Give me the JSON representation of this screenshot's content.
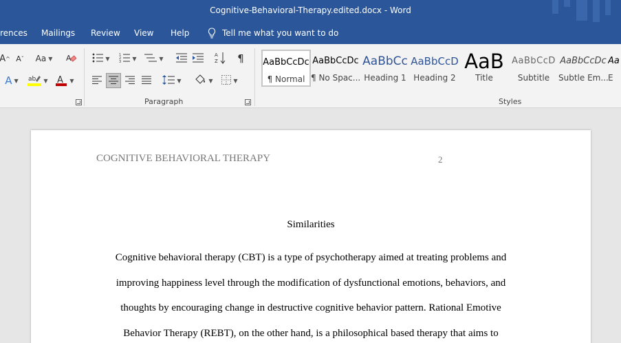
{
  "window": {
    "title": "Cognitive-Behavioral-Therapy.edited.docx  -  Word"
  },
  "ribbon_tabs": [
    "rences",
    "Mailings",
    "Review",
    "View",
    "Help"
  ],
  "tell_me": "Tell me what you want to do",
  "groups": {
    "paragraph": "Paragraph",
    "styles": "Styles"
  },
  "font_group": {
    "change_case": "Aa"
  },
  "styles": [
    {
      "sample": "AaBbCcDc",
      "name": "¶ Normal"
    },
    {
      "sample": "AaBbCcDc",
      "name": "¶ No Spac..."
    },
    {
      "sample": "AaBbCc",
      "name": "Heading 1"
    },
    {
      "sample": "AaBbCcD",
      "name": "Heading 2"
    },
    {
      "sample": "AaB",
      "name": "Title"
    },
    {
      "sample": "AaBbCcD",
      "name": "Subtitle"
    },
    {
      "sample": "AaBbCcDc",
      "name": "Subtle Em..."
    },
    {
      "sample": "Aa",
      "name": "E"
    }
  ],
  "document": {
    "header": "COGNITIVE BEHAVIORAL THERAPY",
    "page_number": "2",
    "heading": "Similarities",
    "lines": [
      "Cognitive behavioral therapy (CBT) is a type of psychotherapy aimed at treating problems and",
      "improving happiness level through the modification of dysfunctional emotions, behaviors, and",
      "thoughts by encouraging change in destructive cognitive behavior pattern. Rational Emotive",
      "Behavior Therapy (REBT), on the other hand, is a philosophical based therapy that aims to"
    ]
  },
  "colors": {
    "title_bar": "#2b579a",
    "ribbon": "#f3f3f3",
    "canvas": "#e6e6e6",
    "heading_blue": "#2f5496",
    "font_red": "#c00000",
    "highlight_yellow": "#ffff00"
  }
}
